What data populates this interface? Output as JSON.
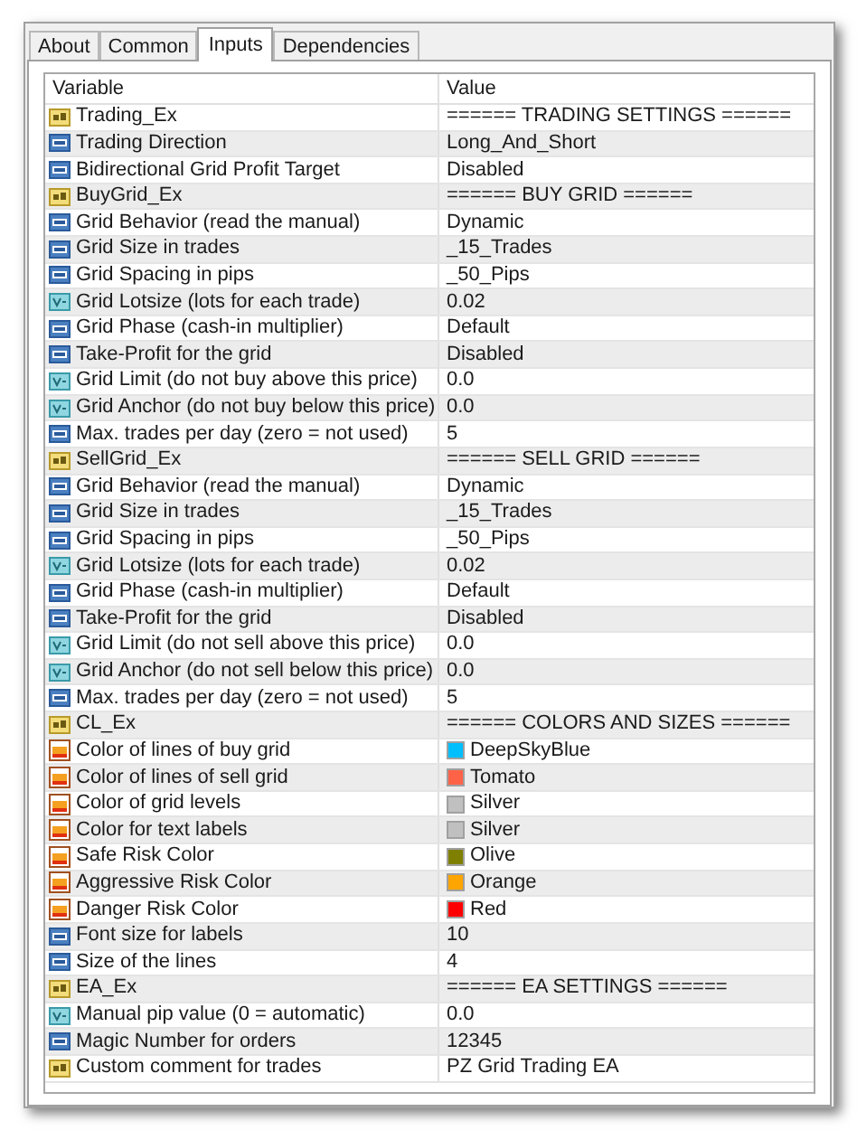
{
  "tabs": [
    {
      "label": "About",
      "selected": false
    },
    {
      "label": "Common",
      "selected": false
    },
    {
      "label": "Inputs",
      "selected": true
    },
    {
      "label": "Dependencies",
      "selected": false
    }
  ],
  "table": {
    "columns": [
      "Variable",
      "Value"
    ],
    "rows": [
      {
        "kind": "string",
        "variable": "Trading_Ex",
        "value": "====== TRADING SETTINGS ======"
      },
      {
        "kind": "enum",
        "variable": "Trading Direction",
        "value": "Long_And_Short"
      },
      {
        "kind": "enum",
        "variable": "Bidirectional Grid Profit Target",
        "value": "Disabled"
      },
      {
        "kind": "string",
        "variable": "BuyGrid_Ex",
        "value": "====== BUY GRID ======"
      },
      {
        "kind": "enum",
        "variable": "Grid Behavior (read the manual)",
        "value": "Dynamic"
      },
      {
        "kind": "enum",
        "variable": "Grid Size in trades",
        "value": "_15_Trades"
      },
      {
        "kind": "enum",
        "variable": "Grid Spacing in pips",
        "value": "_50_Pips"
      },
      {
        "kind": "double",
        "variable": "Grid Lotsize (lots for each trade)",
        "value": "0.02"
      },
      {
        "kind": "enum",
        "variable": "Grid Phase (cash-in multiplier)",
        "value": "Default"
      },
      {
        "kind": "enum",
        "variable": "Take-Profit for the grid",
        "value": "Disabled"
      },
      {
        "kind": "double",
        "variable": "Grid Limit (do not buy above this price)",
        "value": "0.0"
      },
      {
        "kind": "double",
        "variable": "Grid Anchor (do not buy below this price)",
        "value": "0.0"
      },
      {
        "kind": "enum",
        "variable": "Max. trades per day (zero = not used)",
        "value": "5"
      },
      {
        "kind": "string",
        "variable": "SellGrid_Ex",
        "value": "====== SELL GRID ======"
      },
      {
        "kind": "enum",
        "variable": "Grid Behavior (read the manual)",
        "value": "Dynamic"
      },
      {
        "kind": "enum",
        "variable": "Grid Size in trades",
        "value": "_15_Trades"
      },
      {
        "kind": "enum",
        "variable": "Grid Spacing in pips",
        "value": "_50_Pips"
      },
      {
        "kind": "double",
        "variable": "Grid Lotsize (lots for each trade)",
        "value": "0.02"
      },
      {
        "kind": "enum",
        "variable": "Grid Phase (cash-in multiplier)",
        "value": "Default"
      },
      {
        "kind": "enum",
        "variable": "Take-Profit for the grid",
        "value": "Disabled"
      },
      {
        "kind": "double",
        "variable": "Grid Limit (do not sell above this price)",
        "value": "0.0"
      },
      {
        "kind": "double",
        "variable": "Grid Anchor (do not sell below this price)",
        "value": "0.0"
      },
      {
        "kind": "enum",
        "variable": "Max. trades per day (zero = not used)",
        "value": "5"
      },
      {
        "kind": "string",
        "variable": "CL_Ex",
        "value": "====== COLORS AND SIZES ======"
      },
      {
        "kind": "color",
        "variable": "Color of lines of buy grid",
        "value": "DeepSkyBlue",
        "color": "#00bfff"
      },
      {
        "kind": "color",
        "variable": "Color of lines of sell grid",
        "value": "Tomato",
        "color": "#ff6347"
      },
      {
        "kind": "color",
        "variable": "Color of grid levels",
        "value": "Silver",
        "color": "#c0c0c0"
      },
      {
        "kind": "color",
        "variable": "Color for text labels",
        "value": "Silver",
        "color": "#c0c0c0"
      },
      {
        "kind": "color",
        "variable": "Safe Risk Color",
        "value": "Olive",
        "color": "#808000"
      },
      {
        "kind": "color",
        "variable": "Aggressive Risk Color",
        "value": "Orange",
        "color": "#ffa500"
      },
      {
        "kind": "color",
        "variable": "Danger Risk Color",
        "value": "Red",
        "color": "#ff0000"
      },
      {
        "kind": "enum",
        "variable": "Font size for labels",
        "value": "10"
      },
      {
        "kind": "enum",
        "variable": "Size of the lines",
        "value": "4"
      },
      {
        "kind": "string",
        "variable": "EA_Ex",
        "value": "====== EA SETTINGS ======"
      },
      {
        "kind": "double",
        "variable": "Manual pip value (0 = automatic)",
        "value": "0.0"
      },
      {
        "kind": "enum",
        "variable": "Magic Number for orders",
        "value": "12345"
      },
      {
        "kind": "string",
        "variable": "Custom comment for trades",
        "value": "PZ Grid Trading EA"
      }
    ]
  }
}
